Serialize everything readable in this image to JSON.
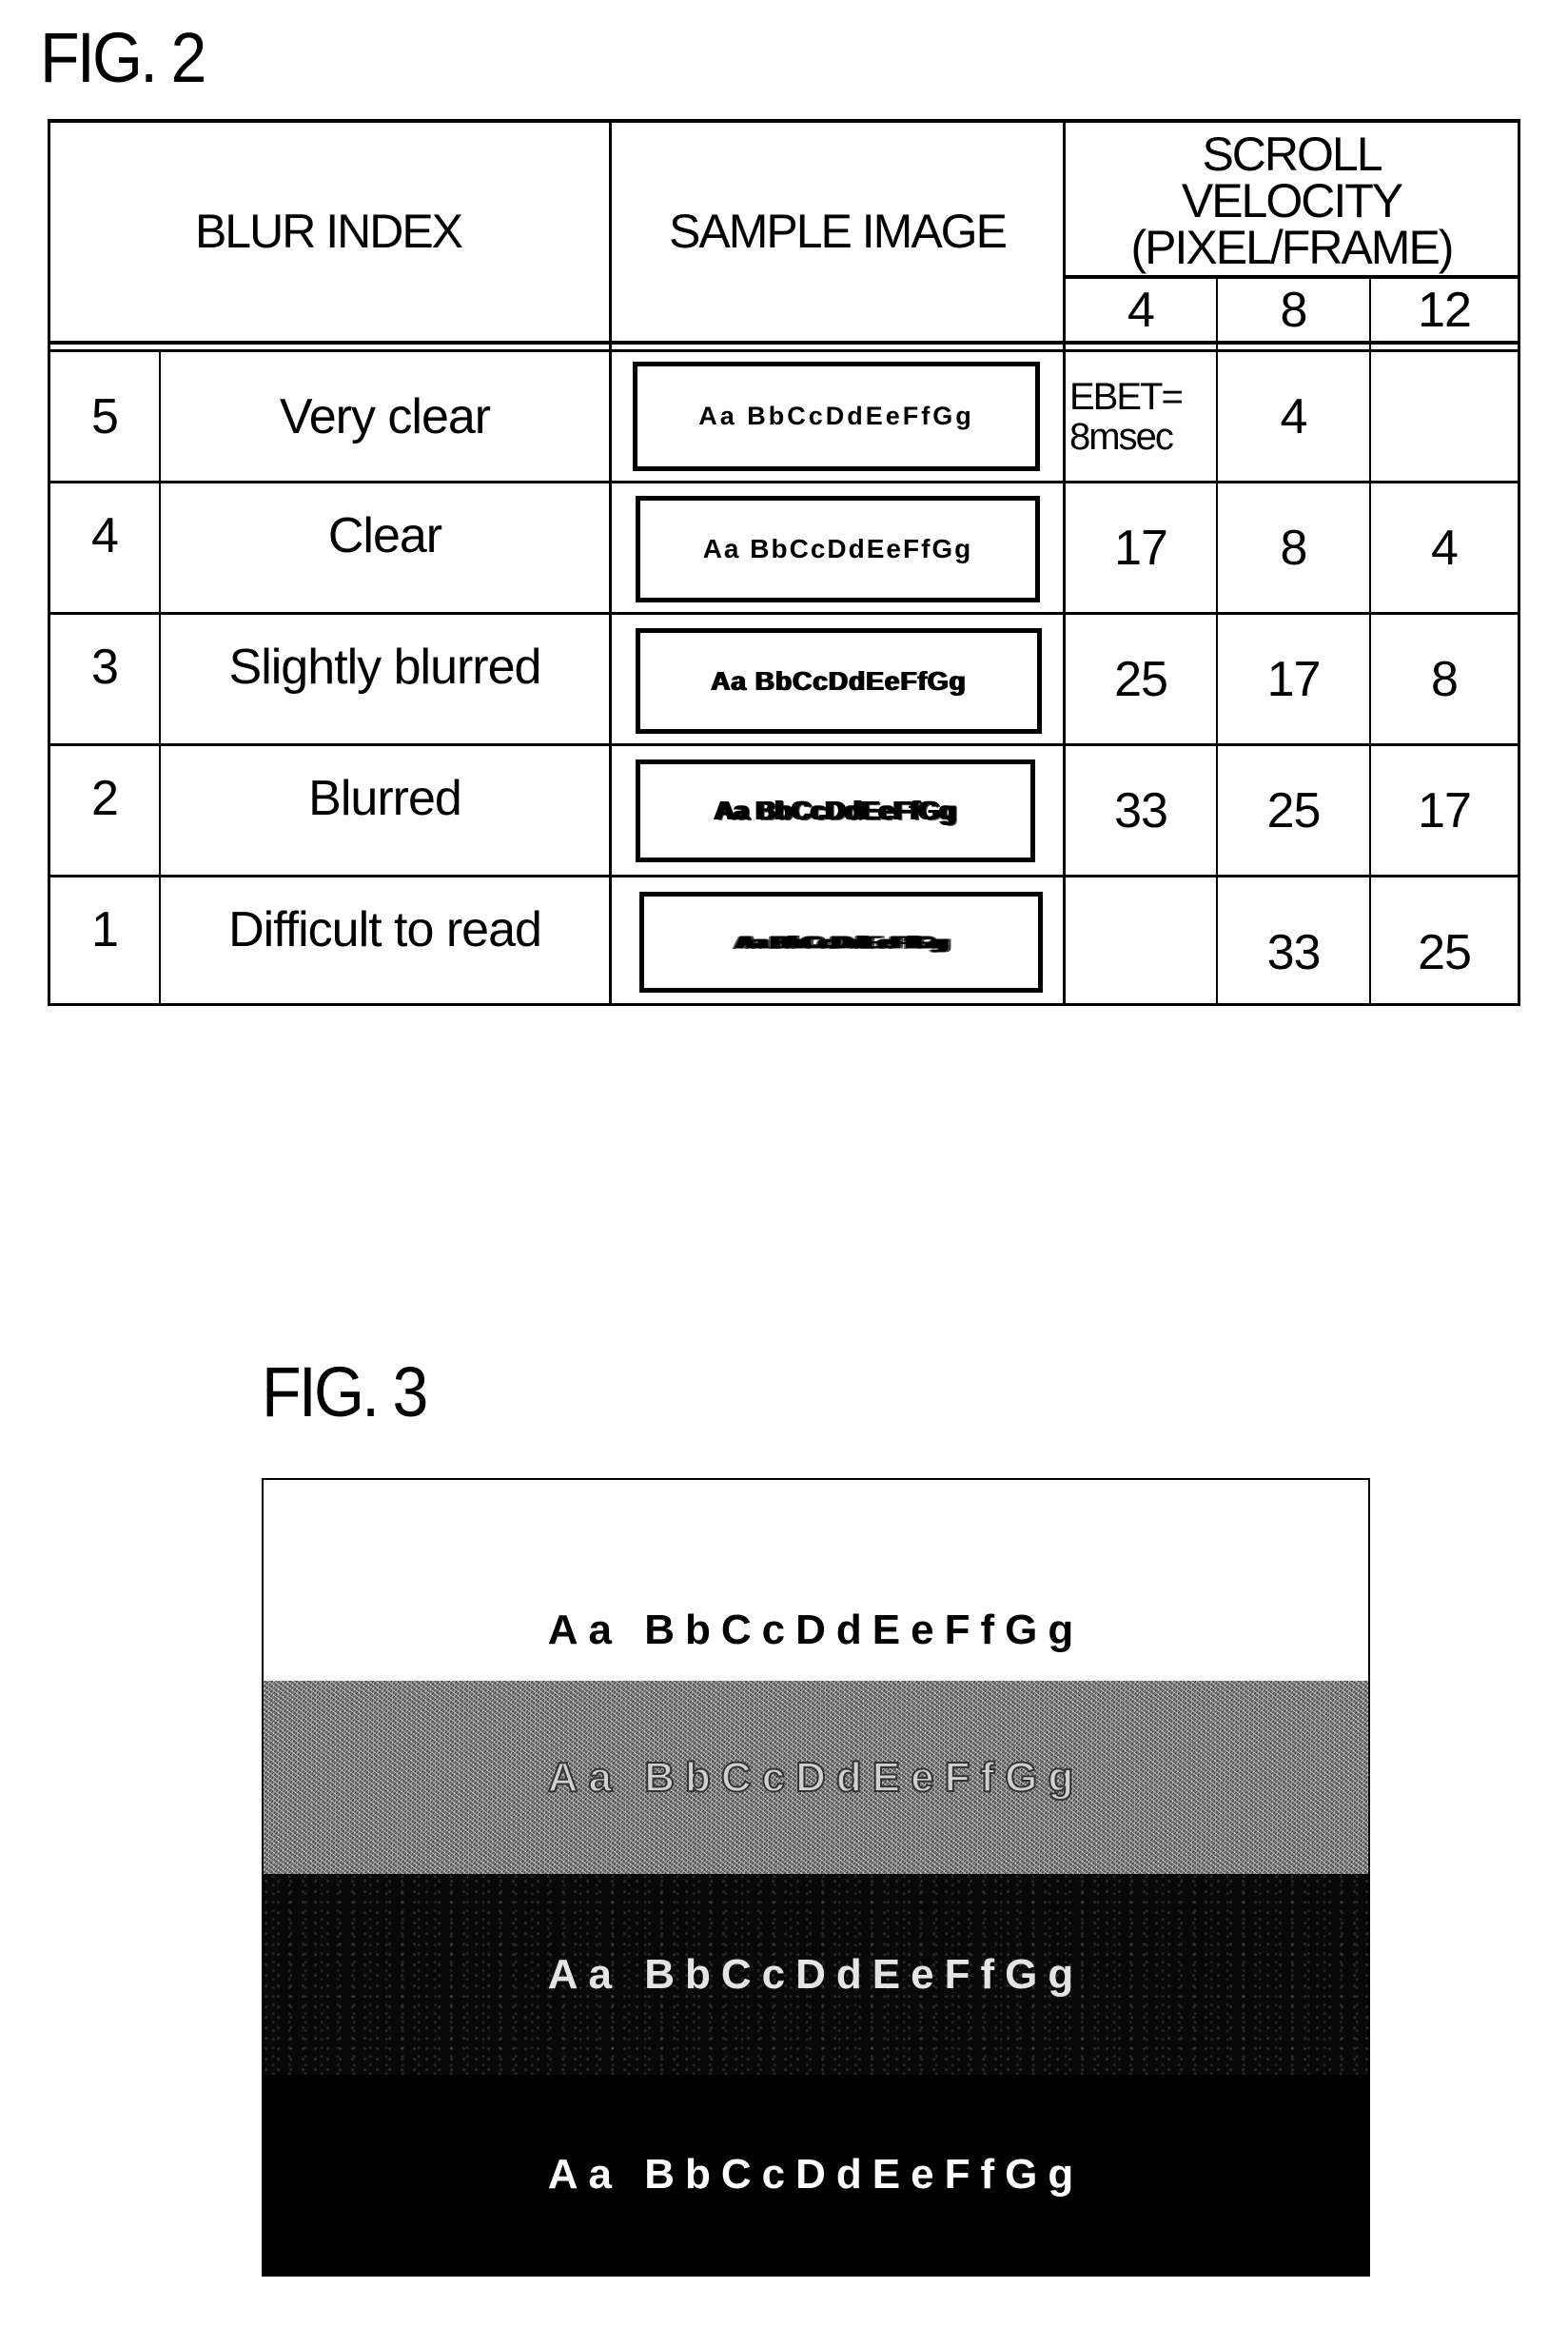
{
  "fig2": {
    "title": "FIG. 2",
    "headers": {
      "blur_index": "BLUR INDEX",
      "sample_image": "SAMPLE IMAGE",
      "scroll_velocity": [
        "SCROLL",
        "VELOCITY",
        "(PIXEL/FRAME)"
      ],
      "velocities": [
        "4",
        "8",
        "12"
      ]
    },
    "rows": [
      {
        "index": "5",
        "label": "Very clear",
        "sample": "Aa BbCcDdEeFfGg",
        "v4": [
          "EBET=",
          "8msec"
        ],
        "v8": "4",
        "v12": ""
      },
      {
        "index": "4",
        "label": "Clear",
        "sample": "Aa BbCcDdEeFfGg",
        "v4": "17",
        "v8": "8",
        "v12": "4"
      },
      {
        "index": "3",
        "label": "Slightly blurred",
        "sample": "Aa BbCcDdEeFfGg",
        "v4": "25",
        "v8": "17",
        "v12": "8"
      },
      {
        "index": "2",
        "label": "Blurred",
        "sample": "Aa BbCcDdEeFfGg",
        "v4": "33",
        "v8": "25",
        "v12": "17"
      },
      {
        "index": "1",
        "label": "Difficult to read",
        "sample": "Aa BbCcDdEeFfGg",
        "v4": "",
        "v8": "33",
        "v12": "25"
      }
    ]
  },
  "fig3": {
    "title": "FIG. 3",
    "bands": [
      {
        "text": "Aa BbCcDdEeFfGg",
        "background": "white"
      },
      {
        "text": "Aa BbCcDdEeFfGg",
        "background": "gray-noise"
      },
      {
        "text": "Aa BbCcDdEeFfGg",
        "background": "dark-noise"
      },
      {
        "text": "Aa BbCcDdEeFfGg",
        "background": "black"
      }
    ]
  }
}
